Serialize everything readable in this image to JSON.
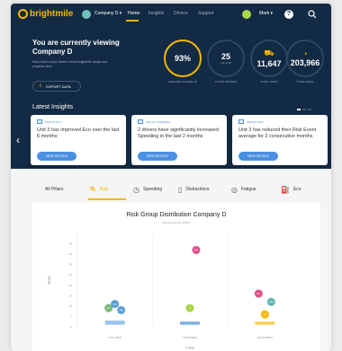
{
  "header": {
    "logo_text": "brightmile",
    "company_selector": "Company D ▾",
    "nav": [
      "Home",
      "Insights",
      "Drivers",
      "Support"
    ],
    "user_name": "Mark ▾",
    "help_glyph": "?"
  },
  "hero": {
    "title": "You are currently viewing Company D",
    "subtitle": "Keep track of your fleet's overall brightmile usage and progress here.",
    "export_label": "EXPORT DATA",
    "kpis": [
      {
        "value": "93%",
        "label": "GREATER SIGNED UP",
        "fraction": 0.93
      },
      {
        "value": "25",
        "sub": "out of 25",
        "label": "ACTIVE DRIVERS"
      },
      {
        "value": "11,647",
        "label": "TOTAL TRIPS",
        "icon": "trips-icon"
      },
      {
        "value": "203,966",
        "label": "TOTAL MILES",
        "icon": "speedometer-icon"
      }
    ]
  },
  "insights": {
    "title": "Latest Insights",
    "cards": [
      {
        "category": "GROUP ECO",
        "text": "Unit 3 has improved Eco over the last 6 months",
        "button": "VIEW DETAILS"
      },
      {
        "category": "GROUP SPEEDING",
        "text": "2 drivers have significantly increased Speeding in the last 2 months",
        "button": "VIEW DETAILS"
      },
      {
        "category": "GROUP RISK",
        "text": "Unit 3 has reduced their Risk Event average for 2 consecutive months",
        "button": "VIEW DETAILS"
      }
    ]
  },
  "tabs": [
    {
      "label": "All Pillars",
      "icon": ""
    },
    {
      "label": "Risk",
      "icon": "risk-icon"
    },
    {
      "label": "Speeding",
      "icon": "speeding-icon"
    },
    {
      "label": "Distractions",
      "icon": "distractions-icon"
    },
    {
      "label": "Fatigue",
      "icon": "fatigue-icon"
    },
    {
      "label": "Eco",
      "icon": "eco-icon"
    }
  ],
  "chart": {
    "title": "Risk Group Distribution Company D",
    "subtitle": "Risk Events per 100km"
  },
  "chart_data": {
    "type": "scatter",
    "title": "Risk Group Distribution Company D",
    "subtitle": "Risk Events per 100km",
    "xlabel": "TYPE",
    "ylabel": "RISK",
    "categories": [
      "OCTOBER",
      "NOVEMBER",
      "DECEMBER"
    ],
    "yticks": [
      0,
      5,
      10,
      15,
      20,
      25,
      30,
      35,
      40
    ],
    "ylim": [
      0,
      45
    ],
    "points": [
      {
        "cat": 0,
        "y": 8,
        "label": "AB",
        "color": "#5a9fd4"
      },
      {
        "cat": 0,
        "y": 11,
        "label": "CD",
        "color": "#5a9fd4"
      },
      {
        "cat": 0,
        "y": 9,
        "label": "EF",
        "color": "#7ab87a"
      },
      {
        "cat": 1,
        "y": 37,
        "label": "GH",
        "color": "#e0508a"
      },
      {
        "cat": 1,
        "y": 9,
        "label": "IJ",
        "color": "#a9d54a"
      },
      {
        "cat": 2,
        "y": 16,
        "label": "KL",
        "color": "#e0508a"
      },
      {
        "cat": 2,
        "y": 12,
        "label": "MN",
        "color": "#5fb5b0"
      },
      {
        "cat": 2,
        "y": 6,
        "label": "OP",
        "color": "#f7b500"
      }
    ],
    "boxes": [
      {
        "cat": 0,
        "low": 1,
        "high": 3,
        "color": "#9cc3ea"
      },
      {
        "cat": 1,
        "low": 1,
        "high": 2.5,
        "color": "#7fb0e0"
      },
      {
        "cat": 2,
        "low": 1,
        "high": 2.5,
        "color": "#f7cf55"
      }
    ],
    "grid": false
  },
  "colors": {
    "navy": "#122a43",
    "accent": "#f7b500",
    "blue": "#4a90e2"
  }
}
